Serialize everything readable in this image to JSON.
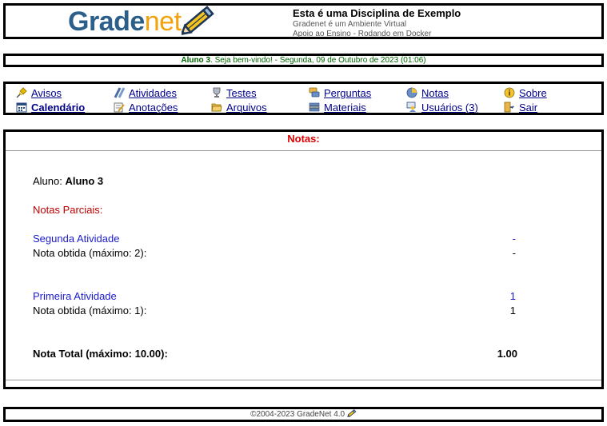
{
  "header": {
    "logo_part1": "Grade",
    "logo_part2": "net",
    "course_title": "Esta é uma Disciplina de Exemplo",
    "subtitle1": "Gradenet é um Ambiente Virtual",
    "subtitle2": "Apoio ao Ensino - Rodando em Docker"
  },
  "welcome": {
    "user": "Aluno 3",
    "message": ". Seja bem-vindo! - Segunda, 09 de Outubro de 2023 (01:06)"
  },
  "nav": {
    "items": [
      {
        "label": "Avisos",
        "icon": "pin-icon"
      },
      {
        "label": "Atividades",
        "icon": "pencils-icon"
      },
      {
        "label": "Testes",
        "icon": "trophy-icon"
      },
      {
        "label": "Perguntas",
        "icon": "chat-icon"
      },
      {
        "label": "Notas",
        "icon": "chart-icon"
      },
      {
        "label": "Sobre",
        "icon": "info-icon"
      },
      {
        "label": "Calendário",
        "icon": "calendar-icon"
      },
      {
        "label": "Anotações",
        "icon": "notepad-icon"
      },
      {
        "label": "Arquivos",
        "icon": "folder-icon"
      },
      {
        "label": "Materiais",
        "icon": "books-icon"
      },
      {
        "label": "Usuários (3)",
        "icon": "users-icon"
      },
      {
        "label": "Sair",
        "icon": "exit-icon"
      }
    ],
    "active": "Calendário"
  },
  "grades": {
    "title": "Notas:",
    "student_label": "Aluno: ",
    "student_name": "Aluno 3",
    "partial_label": "Notas Parciais:",
    "activities": [
      {
        "name": "Segunda Atividade",
        "top_value": "-",
        "grade_label": "Nota obtida (máximo: 2):",
        "grade": "-"
      },
      {
        "name": "Primeira Atividade",
        "top_value": "1",
        "grade_label": "Nota obtida (máximo: 1):",
        "grade": "1"
      }
    ],
    "total_label": "Nota Total (máximo: 10.00):",
    "total_value": "1.00"
  },
  "footer": {
    "text": "©2004-2023 GradeNet 4.0"
  },
  "colors": {
    "logo_blue": "#2b5f8a",
    "logo_orange": "#f2a20c",
    "title_red": "#e00000",
    "link_blue": "#00008b",
    "activity_blue": "#1a1acc",
    "welcome_green": "#006400"
  }
}
